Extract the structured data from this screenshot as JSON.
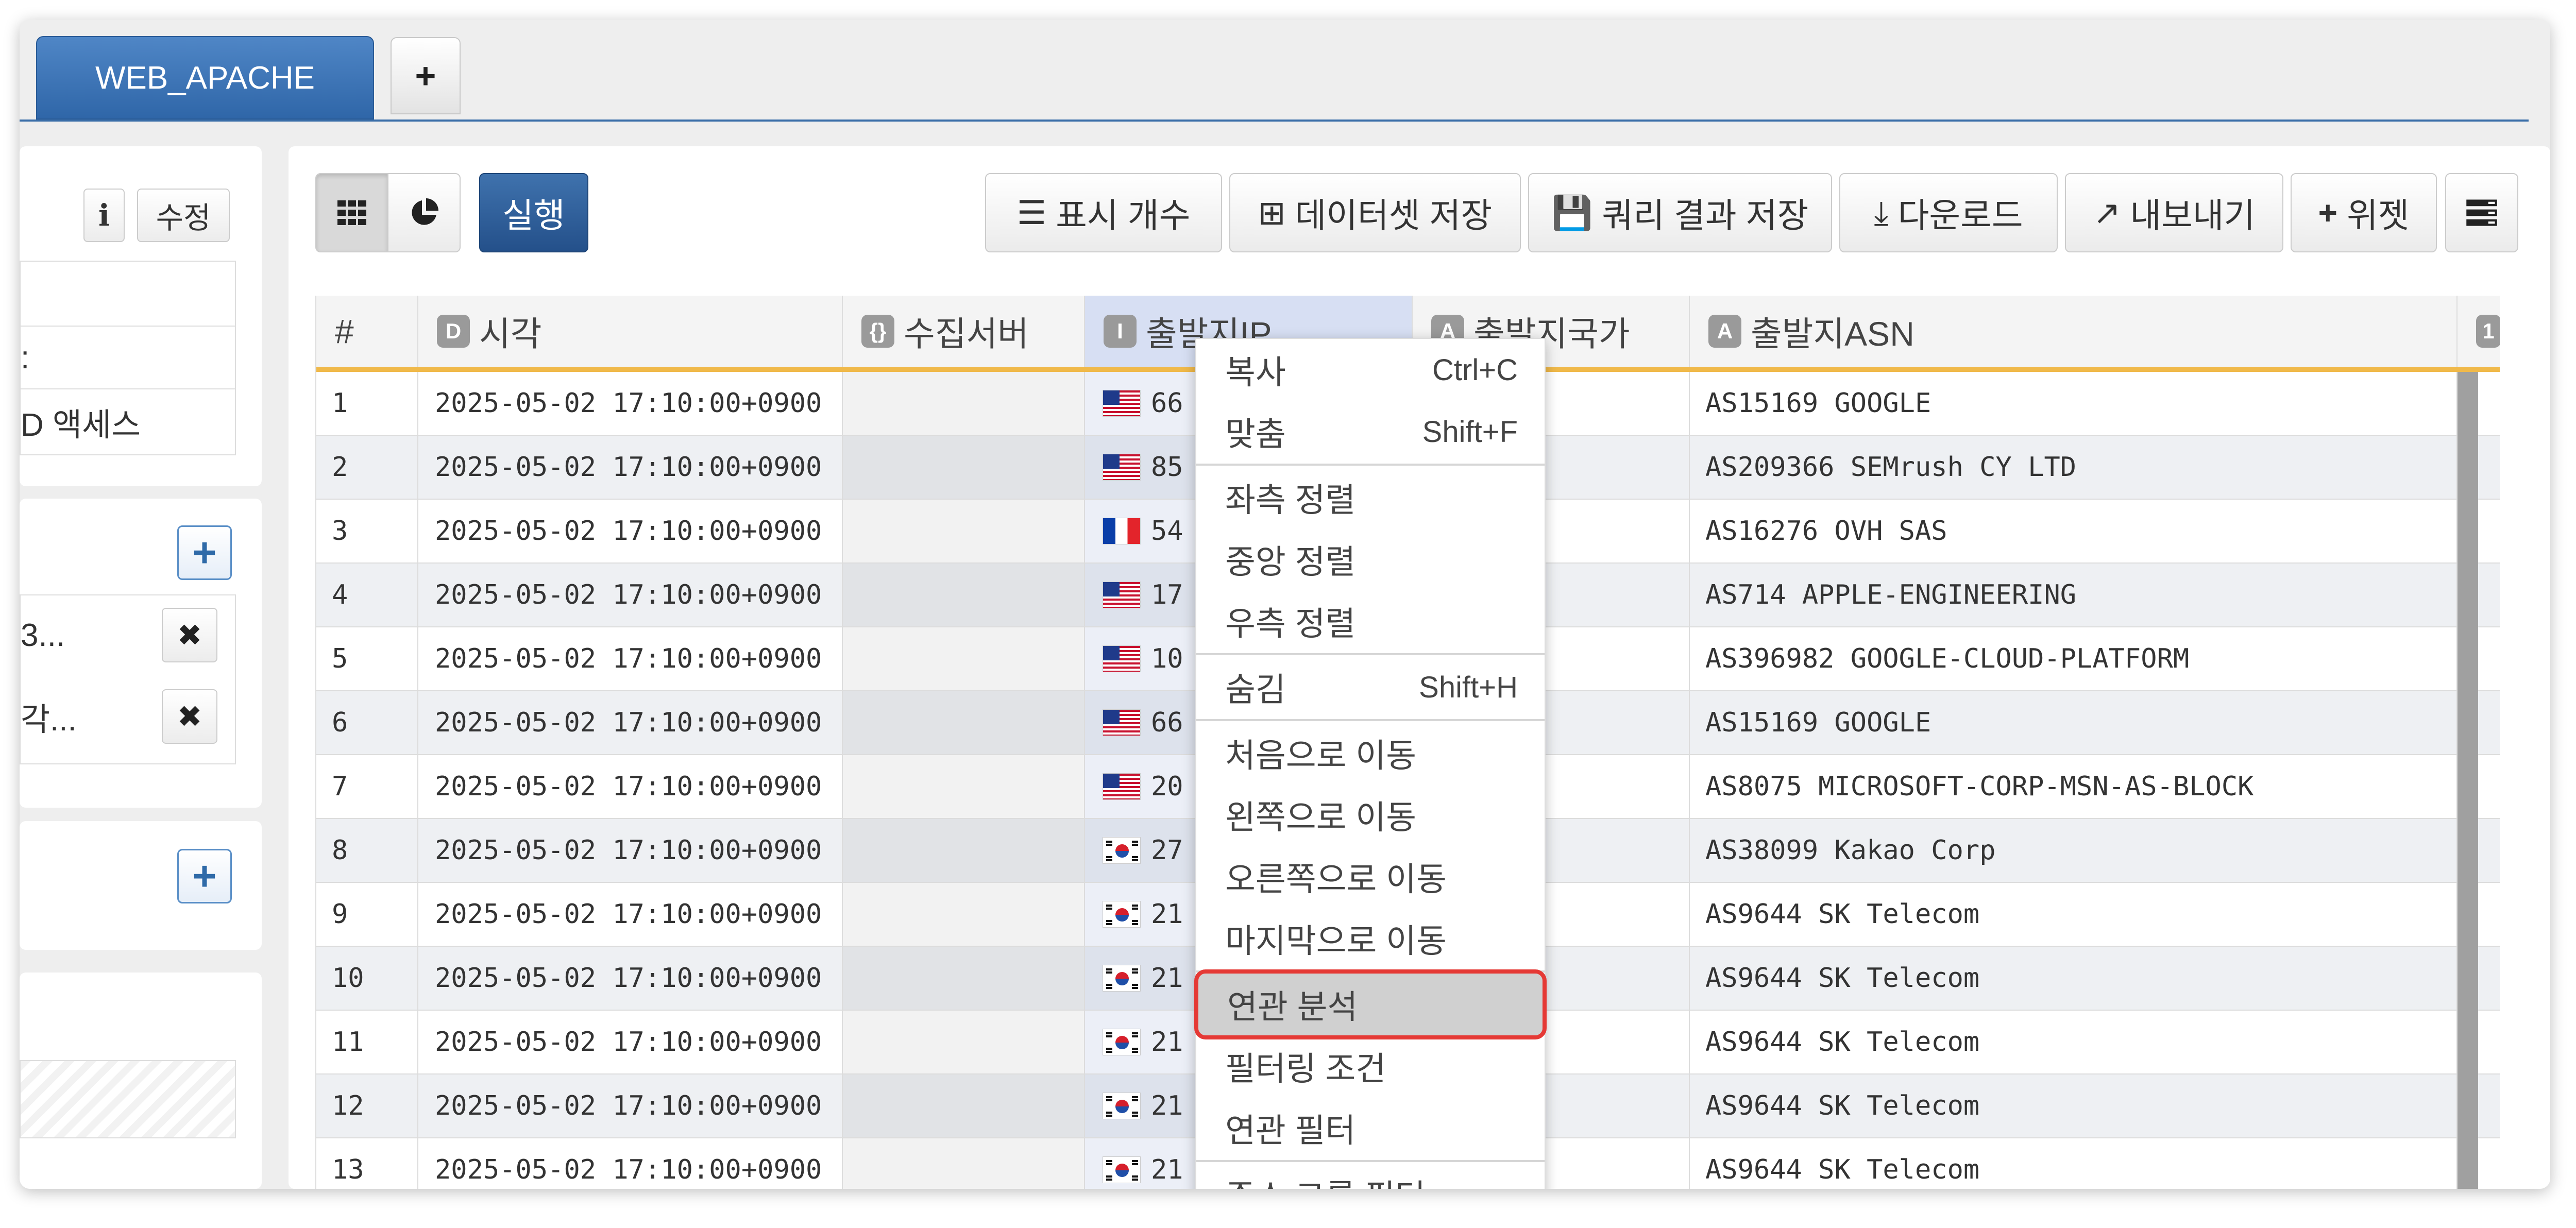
{
  "tabs": [
    {
      "label": "WEB_APACHE"
    }
  ],
  "tab_add_label": "+",
  "left_panel": {
    "info_label": "i",
    "edit_label": "수정",
    "rows": [
      "",
      ":",
      "D 액세스"
    ],
    "filters": [
      "3...",
      "각..."
    ],
    "add_label": "+",
    "remove_label": "✖"
  },
  "toolbar": {
    "grid_icon": "grid-icon",
    "pie_icon": "pie-chart-icon",
    "run_label": "실행",
    "display_count": "표시 개수",
    "save_dataset": "데이터셋 저장",
    "save_query_result": "쿼리 결과 저장",
    "download": "다운로드",
    "export": "내보내기",
    "widget": "위젯"
  },
  "grid": {
    "headers": [
      {
        "label": "#"
      },
      {
        "badge": "D",
        "label": "시각"
      },
      {
        "badge": "{}",
        "label": "수집서버"
      },
      {
        "badge": "I",
        "label": "출발지IP"
      },
      {
        "badge": "A",
        "label": "출발지국가"
      },
      {
        "badge": "A",
        "label": "출발지ASN"
      },
      {
        "badge": "1",
        "label": ""
      }
    ],
    "rows": [
      {
        "n": "1",
        "time": "2025-05-02 17:10:00+0900",
        "flag": "us",
        "ip": "66",
        "asn": "AS15169 GOOGLE"
      },
      {
        "n": "2",
        "time": "2025-05-02 17:10:00+0900",
        "flag": "us",
        "ip": "85",
        "asn": "AS209366 SEMrush CY LTD"
      },
      {
        "n": "3",
        "time": "2025-05-02 17:10:00+0900",
        "flag": "fr",
        "ip": "54",
        "asn": "AS16276 OVH SAS"
      },
      {
        "n": "4",
        "time": "2025-05-02 17:10:00+0900",
        "flag": "us",
        "ip": "17",
        "asn": "AS714 APPLE-ENGINEERING"
      },
      {
        "n": "5",
        "time": "2025-05-02 17:10:00+0900",
        "flag": "us",
        "ip": "10",
        "asn": "AS396982 GOOGLE-CLOUD-PLATFORM"
      },
      {
        "n": "6",
        "time": "2025-05-02 17:10:00+0900",
        "flag": "us",
        "ip": "66",
        "asn": "AS15169 GOOGLE"
      },
      {
        "n": "7",
        "time": "2025-05-02 17:10:00+0900",
        "flag": "us",
        "ip": "20",
        "asn": "AS8075 MICROSOFT-CORP-MSN-AS-BLOCK"
      },
      {
        "n": "8",
        "time": "2025-05-02 17:10:00+0900",
        "flag": "kr",
        "ip": "27",
        "asn": "AS38099 Kakao Corp"
      },
      {
        "n": "9",
        "time": "2025-05-02 17:10:00+0900",
        "flag": "kr",
        "ip": "21",
        "asn": "AS9644 SK Telecom"
      },
      {
        "n": "10",
        "time": "2025-05-02 17:10:00+0900",
        "flag": "kr",
        "ip": "21",
        "asn": "AS9644 SK Telecom"
      },
      {
        "n": "11",
        "time": "2025-05-02 17:10:00+0900",
        "flag": "kr",
        "ip": "21",
        "asn": "AS9644 SK Telecom"
      },
      {
        "n": "12",
        "time": "2025-05-02 17:10:00+0900",
        "flag": "kr",
        "ip": "21",
        "asn": "AS9644 SK Telecom"
      },
      {
        "n": "13",
        "time": "2025-05-02 17:10:00+0900",
        "flag": "kr",
        "ip": "21",
        "asn": "AS9644 SK Telecom"
      }
    ]
  },
  "context_menu": {
    "items": [
      {
        "label": "복사",
        "shortcut": "Ctrl+C"
      },
      {
        "label": "맞춤",
        "shortcut": "Shift+F"
      },
      {
        "label": "좌측 정렬",
        "shortcut": ""
      },
      {
        "label": "중앙 정렬",
        "shortcut": ""
      },
      {
        "label": "우측 정렬",
        "shortcut": ""
      },
      {
        "label": "숨김",
        "shortcut": "Shift+H"
      },
      {
        "label": "처음으로 이동",
        "shortcut": ""
      },
      {
        "label": "왼쪽으로 이동",
        "shortcut": ""
      },
      {
        "label": "오른쪽으로 이동",
        "shortcut": ""
      },
      {
        "label": "마지막으로 이동",
        "shortcut": ""
      },
      {
        "label": "연관 분석",
        "shortcut": "",
        "highlighted": true
      },
      {
        "label": "필터링 조건",
        "shortcut": ""
      },
      {
        "label": "연관 필터",
        "shortcut": ""
      },
      {
        "label": "주소 그룹 필터",
        "shortcut": ""
      }
    ]
  },
  "colors": {
    "accent": "#2f66a8",
    "header_underline": "#f0b94a",
    "highlight_border": "#e53935"
  }
}
